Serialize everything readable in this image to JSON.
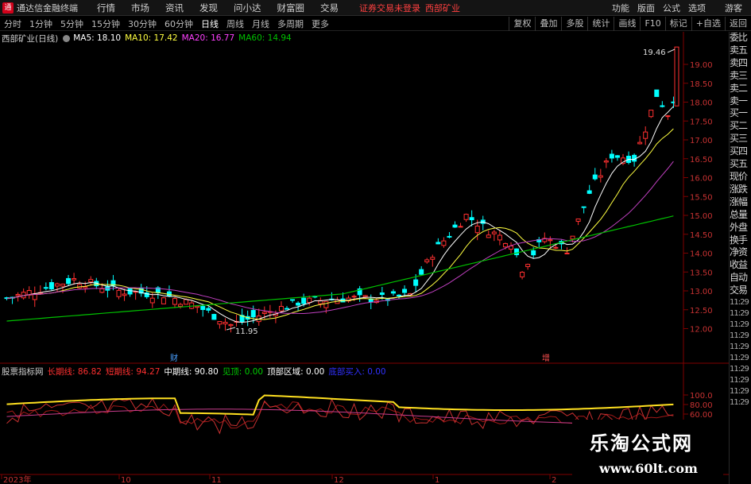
{
  "app": {
    "title": "通达信金融终端",
    "menu": [
      "行情",
      "市场",
      "资讯",
      "发现",
      "问小达",
      "财富圈",
      "交易"
    ],
    "notice": "证券交易未登录",
    "notice_stock": "西部矿业",
    "right_menu": [
      "功能",
      "版面",
      "公式",
      "选项"
    ],
    "guest": "游客"
  },
  "toolbar": {
    "periods": [
      "分时",
      "1分钟",
      "5分钟",
      "15分钟",
      "30分钟",
      "60分钟",
      "日线",
      "周线",
      "月线",
      "多周期",
      "更多"
    ],
    "active_period": "日线",
    "tools": [
      "复权",
      "叠加",
      "多股",
      "统计",
      "画线",
      "F10",
      "标记",
      "+自选",
      "返回"
    ]
  },
  "main_chart": {
    "stock_label": "西部矿业(日线)",
    "ma": [
      {
        "label": "MA5: 18.10",
        "color": "#ffffff"
      },
      {
        "label": "MA10: 17.42",
        "color": "#ffff40"
      },
      {
        "label": "MA20: 16.77",
        "color": "#ff40ff"
      },
      {
        "label": "MA60: 14.94",
        "color": "#00c000"
      }
    ],
    "price_ticks": [
      "19.00",
      "18.50",
      "18.00",
      "17.50",
      "17.00",
      "16.50",
      "16.00",
      "15.50",
      "15.00",
      "14.50",
      "14.00",
      "13.50",
      "13.00",
      "12.50",
      "12.00"
    ],
    "high_label": "19.46",
    "low_label": "11.95",
    "marker_cai": "财",
    "marker_zeng": "增"
  },
  "indicator": {
    "name": "股票指标网",
    "items": [
      {
        "label": "长期线: 86.82",
        "color": "#ff3030"
      },
      {
        "label": "短期线: 94.27",
        "color": "#ff3030"
      },
      {
        "label": "中期线: 90.80",
        "color": "#ffffff"
      },
      {
        "label": "见顶: 0.00",
        "color": "#00d000"
      },
      {
        "label": "顶部区域: 0.00",
        "color": "#ffffff"
      },
      {
        "label": "底部买入: 0.00",
        "color": "#3030ff"
      }
    ],
    "ticks": [
      "100.0",
      "80.00",
      "60.00"
    ]
  },
  "x_axis": [
    "2023年",
    "10",
    "11",
    "12",
    "1",
    "2"
  ],
  "right_panel": {
    "labels": [
      "委比",
      "卖五",
      "卖四",
      "卖三",
      "卖二",
      "卖一",
      "买一",
      "买二",
      "买三",
      "买四",
      "买五",
      "现价",
      "涨跌",
      "涨幅",
      "总量",
      "外盘",
      "换手",
      "净资",
      "收益",
      "自动",
      "交易"
    ],
    "times": [
      "11:29",
      "11:29",
      "11:29",
      "11:29",
      "11:29",
      "11:29",
      "11:29",
      "11:29",
      "11:29",
      "11:29"
    ]
  },
  "watermark": {
    "title": "乐淘公式网",
    "url": "www.60lt.com"
  },
  "colors": {
    "up": "#ff3030",
    "down": "#00ffff",
    "ma5": "#ffffff",
    "ma10": "#ffff40",
    "ma20": "#c040c0",
    "ma60": "#00c000",
    "ind_long": "#a01818",
    "ind_short": "#c83030",
    "ind_mid": "#ffe020",
    "ind_ma": "#c83c8c"
  }
}
